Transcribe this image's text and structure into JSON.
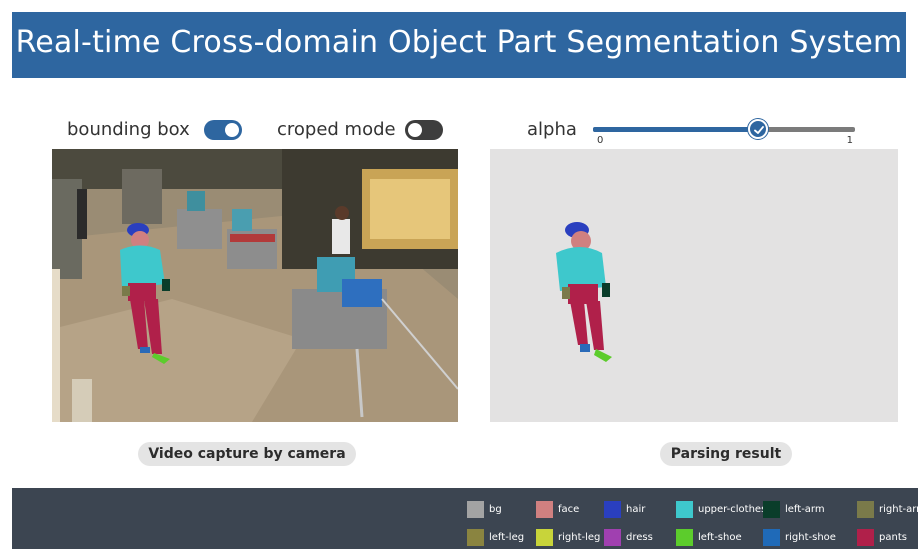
{
  "header": {
    "title": "Real-time Cross-domain Object Part Segmentation System"
  },
  "controls": {
    "bounding_box": {
      "label": "bounding box",
      "state": "on"
    },
    "croped_mode": {
      "label": "croped mode",
      "state": "off"
    },
    "alpha": {
      "label": "alpha",
      "min_label": "0",
      "max_label": "1",
      "value": 0.63
    }
  },
  "panels": {
    "video_caption": "Video capture by camera",
    "parsing_caption": "Parsing result"
  },
  "colors": {
    "header_bg": "#2e66a0",
    "accent": "#2e66a0",
    "legend_bg": "#3c4551",
    "parse_bg": "#e3e2e2"
  },
  "legend": [
    {
      "label": "bg",
      "color": "#a3a3a3"
    },
    {
      "label": "face",
      "color": "#d08080"
    },
    {
      "label": "hair",
      "color": "#2a3fbf"
    },
    {
      "label": "upper-clothes",
      "color": "#3ec8cc"
    },
    {
      "label": "left-arm",
      "color": "#0a3d2a"
    },
    {
      "label": "right-arm",
      "color": "#7a7a4a"
    },
    {
      "label": "left-leg",
      "color": "#8a8440"
    },
    {
      "label": "right-leg",
      "color": "#c8d43a"
    },
    {
      "label": "dress",
      "color": "#a040b0"
    },
    {
      "label": "left-shoe",
      "color": "#5ccc2c"
    },
    {
      "label": "right-shoe",
      "color": "#1f6ab8"
    },
    {
      "label": "pants",
      "color": "#b0204a"
    }
  ]
}
